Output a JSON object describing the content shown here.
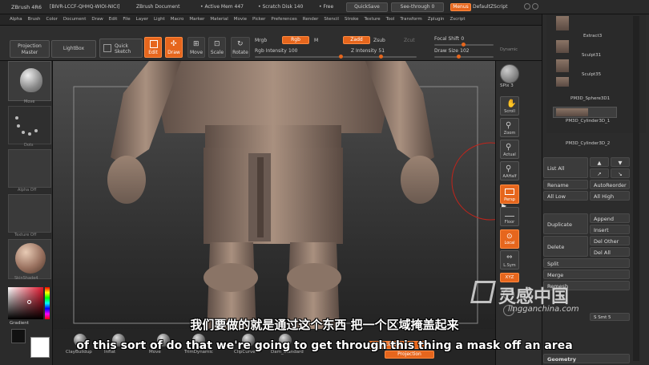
{
  "titlebar": {
    "app_title": "ZBrush 4R6",
    "serial": "[BIVR-LCCF-QHHQ-WIOI-NICI]",
    "document": "ZBrush Document",
    "active_mem": "• Active Mem 447",
    "scratch_disk": "• Scratch Disk 140",
    "free": "• Free",
    "quicksave": "QuickSave",
    "see_through": "See-through 0",
    "menus": "Menus",
    "default_script": "DefaultZScript"
  },
  "menubar": {
    "items": [
      "Alpha",
      "Brush",
      "Color",
      "Document",
      "Draw",
      "Edit",
      "File",
      "Layer",
      "Light",
      "Macro",
      "Marker",
      "Material",
      "Movie",
      "Picker",
      "Preferences",
      "Render",
      "Stencil",
      "Stroke",
      "Texture",
      "Tool",
      "Transform",
      "Zplugin",
      "Zscript"
    ]
  },
  "toolbar": {
    "projection_master": "Projection Master",
    "lightbox": "LightBox",
    "quick_sketch": "Quick Sketch",
    "edit": "Edit",
    "draw": "Draw",
    "move": "Move",
    "scale": "Scale",
    "rotate": "Rotate",
    "mrgb": "Mrgb",
    "rgb": "Rgb",
    "m": "M",
    "zadd": "Zadd",
    "zsub": "Zsub",
    "zcut": "Zcut",
    "rgb_intensity_label": "Rgb Intensity",
    "rgb_intensity_value": "100",
    "z_intensity_label": "Z Intensity",
    "z_intensity_value": "51",
    "focal_shift_label": "Focal Shift",
    "focal_shift_value": "0",
    "draw_size_label": "Draw Size",
    "draw_size_value": "102",
    "dynamic": "Dynamic"
  },
  "leftpanel": {
    "brush_label": "Move",
    "stroke_label": "Dots",
    "alpha_label": "Alpha Off",
    "texture_label": "Texture Off",
    "material_label": "SkinShade4",
    "gradient_label": "Gradient"
  },
  "shelf": {
    "spix": "SPix",
    "spix_value": "3",
    "scroll": "Scroll",
    "zoom": "Zoom",
    "actual": "Actual",
    "aahalf": "AAHalf",
    "persp": "Persp",
    "floor": "Floor",
    "local": "Local",
    "lsym": "L.Sym",
    "xyz": "XYZ"
  },
  "rightpanel": {
    "subtools": [
      "Extract3",
      "Sculpt31",
      "Sculpt35",
      "PM3D_Sphere3D1",
      "PM3D_Cylinder3D_1",
      "PM3D_Cylinder3D_2"
    ],
    "list_all": "List All",
    "rename": "Rename",
    "auto_reorder": "AutoReorder",
    "all_low": "All Low",
    "all_high": "All High",
    "duplicate": "Duplicate",
    "append": "Append",
    "insert": "Insert",
    "delete": "Delete",
    "del_other": "Del Other",
    "del_all": "Del All",
    "split": "Split",
    "merge": "Merge",
    "remesh": "Remesh",
    "s_smt": "S Smt 5",
    "geometry": "Geometry"
  },
  "bottombar": {
    "brushes": [
      "ClayBuildup",
      "Inflat",
      "Move",
      "TrimDynamic",
      "ClipCurve",
      "Dam_Standard"
    ],
    "backface": "BackfaceMask",
    "projection": "Projection"
  },
  "subtitles": {
    "cn": "我们要做的就是通过这个东西 把一个区域掩盖起来",
    "en": "of this sort of do that we're going to get through this thing a mask off an area"
  },
  "watermark": {
    "cn": "灵感中国",
    "en": "lingganchina.com"
  },
  "colors": {
    "accent": "#e6661d"
  }
}
